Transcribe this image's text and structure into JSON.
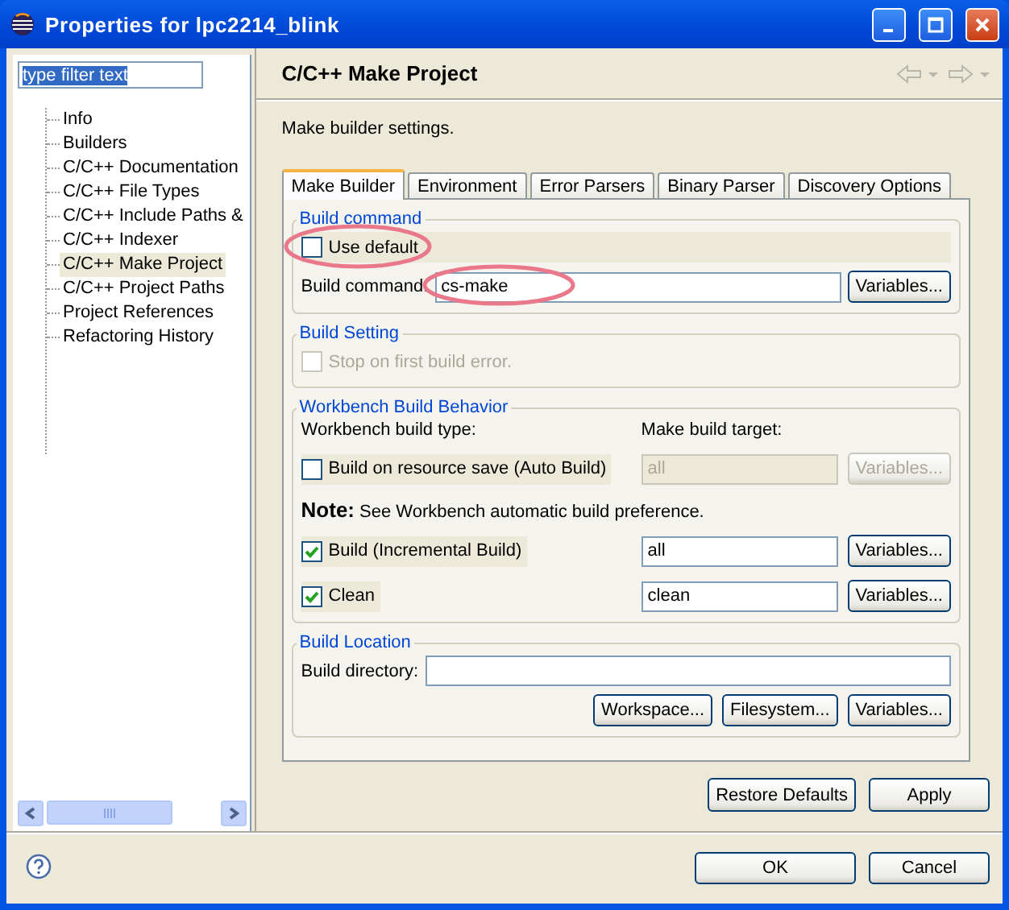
{
  "window": {
    "title": "Properties for lpc2214_blink"
  },
  "filter": {
    "value": "type filter text",
    "text_selected": true
  },
  "tree": {
    "items": [
      {
        "label": "Info",
        "selected": false
      },
      {
        "label": "Builders",
        "selected": false
      },
      {
        "label": "C/C++ Documentation",
        "selected": false
      },
      {
        "label": "C/C++ File Types",
        "selected": false
      },
      {
        "label": "C/C++ Include Paths &",
        "selected": false
      },
      {
        "label": "C/C++ Indexer",
        "selected": false
      },
      {
        "label": "C/C++ Make Project",
        "selected": true
      },
      {
        "label": "C/C++ Project Paths",
        "selected": false
      },
      {
        "label": "Project References",
        "selected": false
      },
      {
        "label": "Refactoring History",
        "selected": false
      }
    ]
  },
  "page": {
    "title": "C/C++ Make Project",
    "description": "Make builder settings."
  },
  "tabs": [
    {
      "label": "Make Builder",
      "selected": true
    },
    {
      "label": "Environment",
      "selected": false
    },
    {
      "label": "Error Parsers",
      "selected": false
    },
    {
      "label": "Binary Parser",
      "selected": false
    },
    {
      "label": "Discovery Options",
      "selected": false
    }
  ],
  "build_command": {
    "title": "Build command",
    "use_default": {
      "label": "Use default",
      "checked": false,
      "annotated": true
    },
    "label": "Build command:",
    "value": "cs-make",
    "annotated": true,
    "button": "Variables..."
  },
  "build_setting": {
    "title": "Build Setting",
    "stop_on_error": {
      "label": "Stop on first build error.",
      "checked": false,
      "disabled": true
    }
  },
  "behavior": {
    "title": "Workbench Build Behavior",
    "type_label": "Workbench build type:",
    "target_label": "Make build target:",
    "items": [
      {
        "kind": "trigger",
        "label": "Build on resource save (Auto Build)",
        "checked": false,
        "target": "all",
        "button": "Variables..."
      },
      {
        "kind": "note",
        "label": "Note:",
        "text": "See Workbench automatic build preference."
      },
      {
        "kind": "trigger",
        "label": "Build (Incremental Build)",
        "checked": true,
        "target": "all",
        "button": "Variables..."
      },
      {
        "kind": "trigger",
        "label": "Clean",
        "checked": true,
        "target": "clean",
        "button": "Variables..."
      }
    ]
  },
  "location": {
    "title": "Build Location",
    "label": "Build directory:",
    "buttons": [
      "Workspace...",
      "Filesystem...",
      "Variables..."
    ]
  },
  "page_buttons": [
    "Restore Defaults",
    "Apply"
  ],
  "dialog_buttons": [
    "OK",
    "Cancel"
  ]
}
